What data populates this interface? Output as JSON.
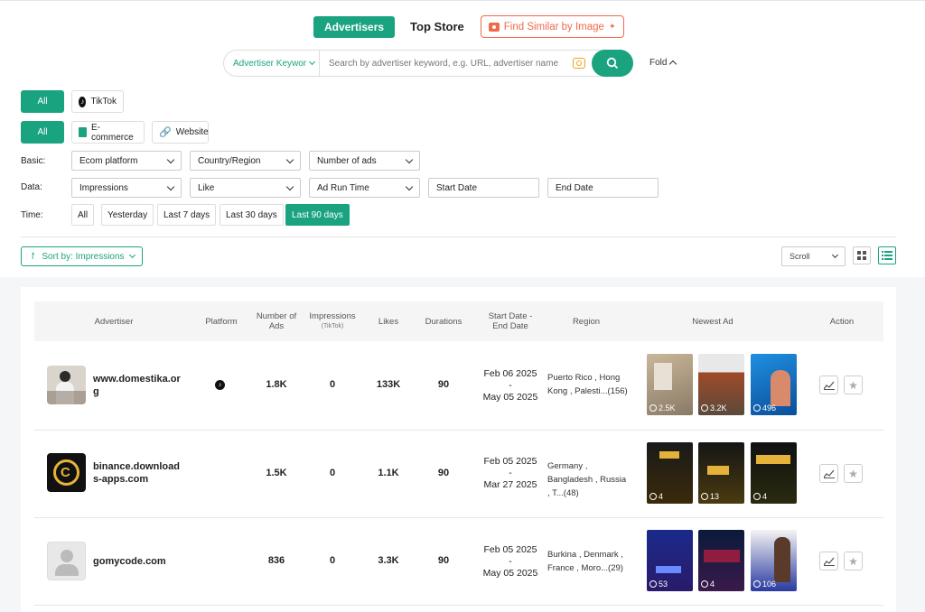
{
  "tabs": {
    "advertisers": "Advertisers",
    "top_store": "Top Store",
    "find_similar": "Find Similar by Image",
    "sparkle": "⁺+"
  },
  "search": {
    "keyword_type": "Advertiser Keywor",
    "placeholder": "Search by advertiser keyword, e.g. URL, advertiser name",
    "fold": "Fold"
  },
  "platform_filter": {
    "all": "All",
    "tiktok": "TikTok"
  },
  "category_filter": {
    "all": "All",
    "ecommerce": "E-commerce",
    "website": "Website"
  },
  "filters": {
    "basic_label": "Basic:",
    "data_label": "Data:",
    "time_label": "Time:",
    "ecom_platform": "Ecom platform",
    "country_region": "Country/Region",
    "number_of_ads": "Number of ads",
    "impressions": "Impressions",
    "like": "Like",
    "ad_run_time": "Ad Run Time",
    "start_date": "Start Date",
    "end_date": "End Date",
    "time_options": [
      "All",
      "Yesterday",
      "Last 7 days",
      "Last 30 days",
      "Last 90 days"
    ],
    "time_selected": "Last 90 days"
  },
  "sort": {
    "label": "Sort by: Impressions",
    "scroll": "Scroll"
  },
  "table": {
    "headers": {
      "advertiser": "Advertiser",
      "platform": "Platform",
      "number_of_ads": "Number of Ads",
      "impressions": "Impressions",
      "impressions_sub": "(TikTok)",
      "likes": "Likes",
      "durations": "Durations",
      "start_end": "Start Date - End Date",
      "region": "Region",
      "newest_ad": "Newest Ad",
      "action": "Action"
    },
    "rows": [
      {
        "name": "www.domestika.org",
        "ads": "1.8K",
        "impressions": "0",
        "likes": "133K",
        "duration": "90",
        "start": "Feb 06 2025",
        "sep": "-",
        "end": "May 05 2025",
        "region": "Puerto Rico , Hong Kong , Palesti...(156)",
        "ad_counts": [
          "2.5K",
          "3.2K",
          "496"
        ]
      },
      {
        "name": "binance.downloads-apps.com",
        "ads": "1.5K",
        "impressions": "0",
        "likes": "1.1K",
        "duration": "90",
        "start": "Feb 05 2025",
        "sep": "-",
        "end": "Mar 27 2025",
        "region": "Germany , Bangladesh , Russia , T...(48)",
        "ad_counts": [
          "4",
          "13",
          "4"
        ]
      },
      {
        "name": "gomycode.com",
        "ads": "836",
        "impressions": "0",
        "likes": "3.3K",
        "duration": "90",
        "start": "Feb 05 2025",
        "sep": "-",
        "end": "May 05 2025",
        "region": "Burkina , Denmark , France , Moro...(29)",
        "ad_counts": [
          "53",
          "4",
          "106"
        ]
      }
    ]
  },
  "colors": {
    "accent": "#1aa37f",
    "orange": "#f06a4a"
  }
}
